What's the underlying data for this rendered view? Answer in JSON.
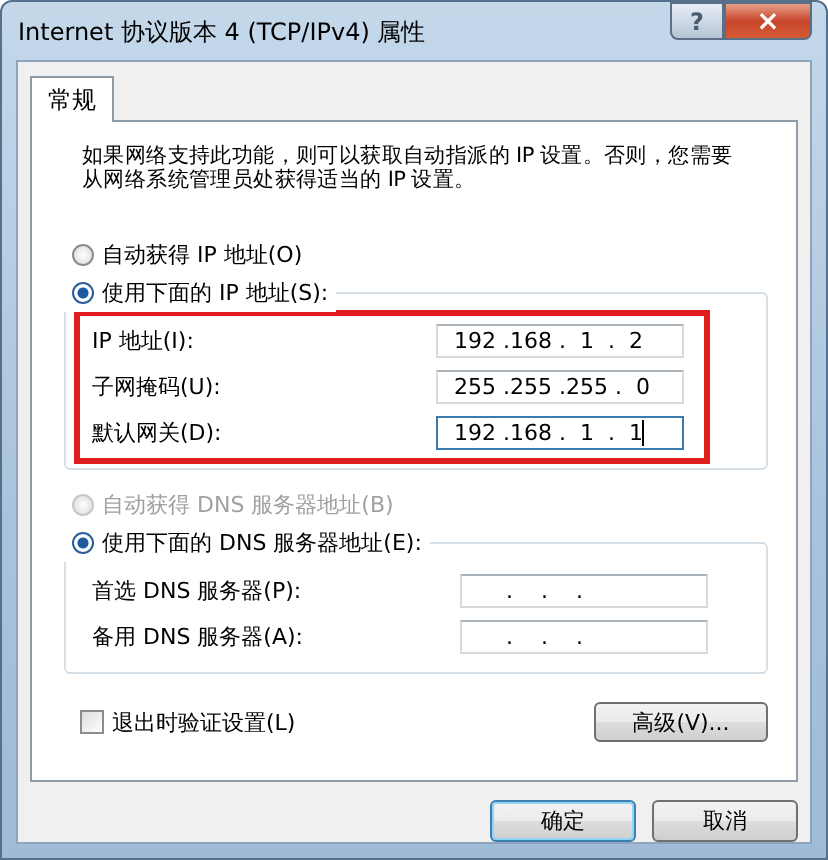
{
  "window": {
    "title": "Internet 协议版本 4 (TCP/IPv4) 属性",
    "help": "?",
    "close": "×"
  },
  "tabs": [
    {
      "label": "常规",
      "selected": true
    }
  ],
  "description": "如果网络支持此功能，则可以获取自动指派的 IP 设置。否则，您需要从网络系统管理员处获得适当的 IP 设置。",
  "ip_mode": [
    {
      "label": "自动获得 IP 地址(O)",
      "selected": false,
      "disabled": false
    },
    {
      "label": "使用下面的 IP 地址(S):",
      "selected": true,
      "disabled": false
    }
  ],
  "ip_fields": [
    {
      "label": "IP 地址(I):",
      "value": "192 .168 .  1  .  2",
      "focused": false
    },
    {
      "label": "子网掩码(U):",
      "value": "255 .255 .255 .  0",
      "focused": false
    },
    {
      "label": "默认网关(D):",
      "value": "192 .168 .  1  .  1",
      "focused": true
    }
  ],
  "highlight": true,
  "dns_mode": [
    {
      "label": "自动获得 DNS 服务器地址(B)",
      "selected": false,
      "disabled": true
    },
    {
      "label": "使用下面的 DNS 服务器地址(E):",
      "selected": true,
      "disabled": false
    }
  ],
  "dns_fields": [
    {
      "label": "首选 DNS 服务器(P):",
      "value": "    .    .    .",
      "focused": false
    },
    {
      "label": "备用 DNS 服务器(A):",
      "value": "    .    .    .",
      "focused": false
    }
  ],
  "validate": {
    "label": "退出时验证设置(L)",
    "checked": false
  },
  "advanced_button": "高级(V)...",
  "buttons": [
    {
      "label": "确定",
      "default": true
    },
    {
      "label": "取消",
      "default": false
    }
  ]
}
